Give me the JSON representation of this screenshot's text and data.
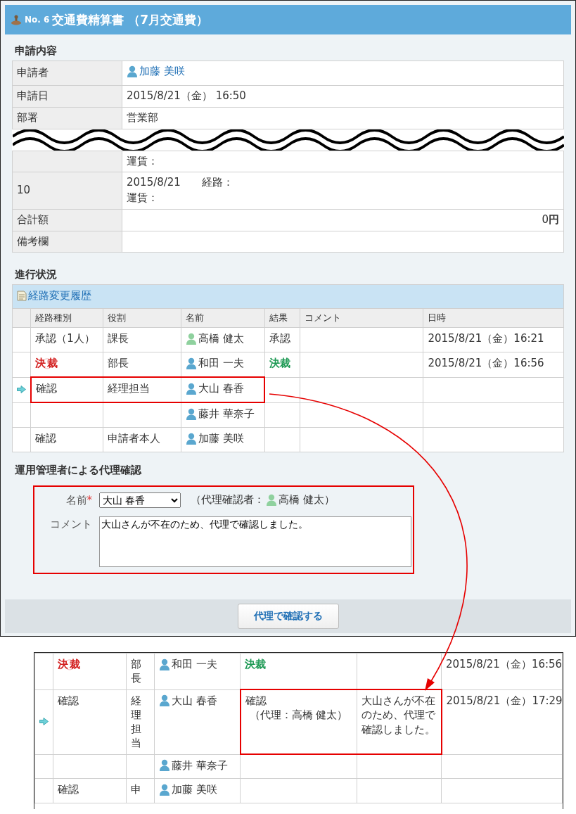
{
  "header": {
    "number": "No. 6",
    "title": "交通費精算書 （7月交通費）"
  },
  "details": {
    "title": "申請内容",
    "rows": [
      {
        "kind": "person",
        "label": "申請者",
        "person": {
          "name": "加藤 美咲",
          "color": "#5aa7cf"
        }
      },
      {
        "kind": "text",
        "label": "申請日",
        "value": "2015/8/21（金） 16:50"
      },
      {
        "kind": "text",
        "label": "部署",
        "value": "営業部"
      },
      {
        "kind": "break"
      },
      {
        "kind": "lines",
        "lines": [
          "運賃："
        ]
      },
      {
        "kind": "lines",
        "label": "10",
        "lines": [
          "2015/8/21　　経路：",
          "運賃："
        ]
      },
      {
        "kind": "amount",
        "label": "合計額",
        "value": "0**円**"
      },
      {
        "kind": "text",
        "label": "備考欄"
      }
    ]
  },
  "progress": {
    "title": "進行状況",
    "history_link": "経路変更履歴",
    "columns": [
      "経路種別",
      "役割",
      "名前",
      "結果",
      "コメント",
      "日時"
    ],
    "highlight_right_side": false,
    "rows": [
      {
        "current": false,
        "highlighted": false,
        "type": {
          "kind": "text",
          "text": "承認（1人）"
        },
        "role": "課長",
        "person": {
          "name": "高橋 健太",
          "color": "#8fd19e"
        },
        "result": "承認",
        "result_final": false,
        "date": "2015/8/21（金）16:21"
      },
      {
        "current": false,
        "highlighted": false,
        "type": {
          "kind": "stamp",
          "text": "決裁"
        },
        "role": "部長",
        "person": {
          "name": "和田 一夫",
          "color": "#5aa7cf"
        },
        "result": "決裁",
        "result_final": true,
        "date": "2015/8/21（金）16:56"
      },
      {
        "current": true,
        "highlighted": true,
        "type": {
          "kind": "text",
          "text": "確認"
        },
        "role": "経理担当",
        "person": {
          "name": "大山 春香",
          "color": "#5aa7cf"
        }
      },
      {
        "current": false,
        "highlighted": false,
        "person": {
          "name": "藤井 華奈子",
          "color": "#5aa7cf"
        }
      },
      {
        "current": false,
        "highlighted": false,
        "type": {
          "kind": "text",
          "text": "確認"
        },
        "role": "申請者本人",
        "person": {
          "name": "加藤 美咲",
          "color": "#5aa7cf"
        }
      }
    ]
  },
  "proxy": {
    "title": "運用管理者による代理確認",
    "name_label": "名前",
    "required_mark": "*",
    "selected_name": "大山 春香",
    "proxy_prefix": "（代理確認者：",
    "proxy_person": {
      "name": "高橋 健太",
      "color": "#8fd19e"
    },
    "proxy_suffix": "）",
    "comment_label": "コメント",
    "comment": "大山さんが不在のため、代理で確認しました。",
    "button": "代理で確認する"
  },
  "result_view": {
    "highlight_right_side": true,
    "rows": [
      {
        "current": false,
        "highlighted": false,
        "type": {
          "kind": "stamp",
          "text": "決裁"
        },
        "role": "部長",
        "person": {
          "name": "和田 一夫",
          "color": "#5aa7cf"
        },
        "result": "決裁",
        "result_final": true,
        "date": "2015/8/21（金）16:56"
      },
      {
        "current": true,
        "highlighted": true,
        "type": {
          "kind": "text",
          "text": "確認"
        },
        "role": "経理担当",
        "person": {
          "name": "大山 春香",
          "color": "#5aa7cf"
        },
        "result": "確認",
        "result_note": "（代理：高橋 健太）",
        "result_final": false,
        "comment": "大山さんが不在のため、代理で確認しました。",
        "date": "2015/8/21（金）17:29"
      },
      {
        "current": false,
        "highlighted": false,
        "person": {
          "name": "藤井 華奈子",
          "color": "#5aa7cf"
        }
      },
      {
        "current": false,
        "highlighted": false,
        "type": {
          "kind": "text",
          "text": "確認"
        },
        "role": "申",
        "person": {
          "name": "加藤 美咲",
          "color": "#5aa7cf"
        }
      }
    ]
  }
}
